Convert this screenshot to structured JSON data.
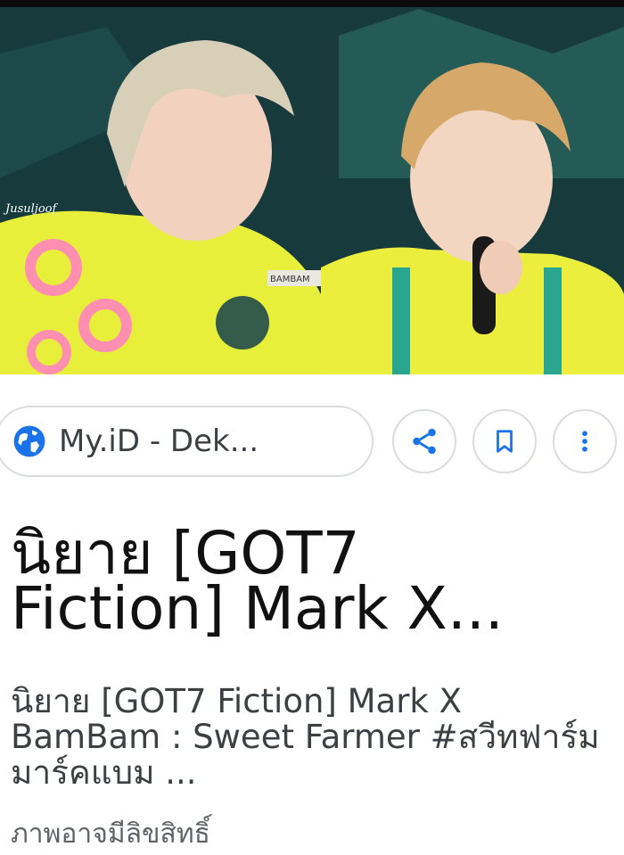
{
  "image": {
    "watermark": "Jusuljoof",
    "badge_text": "BAMBAM"
  },
  "source": {
    "icon": "globe-icon",
    "label": "My.iD - Dek..."
  },
  "actions": {
    "share_icon": "share-icon",
    "save_icon": "bookmark-icon",
    "more_icon": "more-vert-icon"
  },
  "result": {
    "title_line1": "นิยาย [GOT7",
    "title_line2": "Fiction] Mark X...",
    "description": "นิยาย [GOT7 Fiction] Mark X BamBam : Sweet Farmer #สวีทฟาร์มมาร์คแบม ...",
    "footer": "ภาพอาจมีลิขสิทธิ์"
  },
  "colors": {
    "accent": "#1a73e8",
    "border": "#dadce0",
    "text_primary": "#111111",
    "text_secondary": "#3c4043"
  }
}
